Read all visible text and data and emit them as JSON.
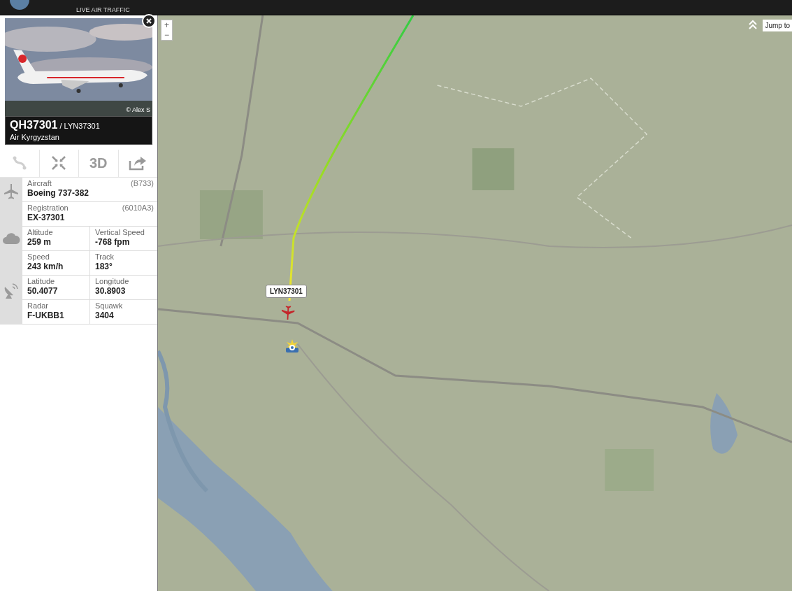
{
  "header": {
    "subtitle": "LIVE AIR TRAFFIC"
  },
  "flight_card": {
    "photo_credit": "© Alex S",
    "flight": "QH37301",
    "callsign": "/ LYN37301",
    "airline": "Air Kyrgyzstan"
  },
  "actions": [
    {
      "kind": "route"
    },
    {
      "kind": "collapse"
    },
    {
      "kind": "view",
      "label": "3D"
    },
    {
      "kind": "share"
    }
  ],
  "details": [
    {
      "kind": "aircraft",
      "rows": [
        [
          {
            "label": "Aircraft",
            "value": "Boeing 737-382",
            "code": "(B733)"
          }
        ],
        [
          {
            "label": "Registration",
            "value": "EX-37301",
            "code": "(6010A3)"
          }
        ]
      ]
    },
    {
      "kind": "flight",
      "rows": [
        [
          {
            "label": "Altitude",
            "value": "259 m"
          },
          {
            "label": "Vertical Speed",
            "value": "-768 fpm"
          }
        ],
        [
          {
            "label": "Speed",
            "value": "243 km/h"
          },
          {
            "label": "Track",
            "value": "183°"
          }
        ]
      ]
    },
    {
      "kind": "position",
      "rows": [
        [
          {
            "label": "Latitude",
            "value": "50.4077"
          },
          {
            "label": "Longitude",
            "value": "30.8903"
          }
        ],
        [
          {
            "label": "Radar",
            "value": "F-UKBB1"
          },
          {
            "label": "Squawk",
            "value": "3404"
          }
        ]
      ]
    }
  ],
  "map": {
    "zoom": [
      "+",
      "−"
    ],
    "jump_to": "Jump to",
    "flight_label": "LYN37301"
  }
}
